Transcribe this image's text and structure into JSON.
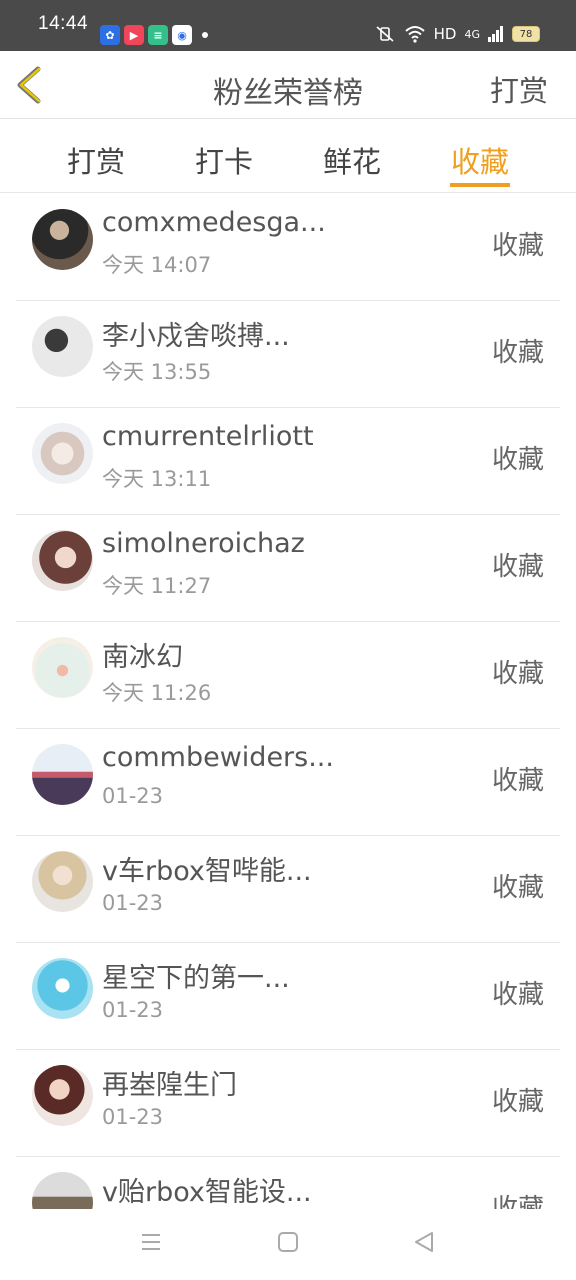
{
  "status_bar": {
    "time": "14:44",
    "network": "HD",
    "signal": "4G",
    "battery": "78"
  },
  "nav": {
    "title": "粉丝荣誉榜",
    "right_action": "打赏"
  },
  "tabs": [
    {
      "label": "打赏",
      "active": false
    },
    {
      "label": "打卡",
      "active": false
    },
    {
      "label": "鲜花",
      "active": false
    },
    {
      "label": "收藏",
      "active": true
    }
  ],
  "colors": {
    "accent": "#f0a020",
    "status_bar_bg": "#4a4a4a"
  },
  "fans": [
    {
      "name": "comxmedesga...",
      "time": "今天 14:07",
      "action": "收藏"
    },
    {
      "name": "李小戍舍啖搏...",
      "time": "今天 13:55",
      "action": "收藏"
    },
    {
      "name": "cmurrentelrliott",
      "time": "今天 13:11",
      "action": "收藏"
    },
    {
      "name": "simolneroichaz",
      "time": "今天 11:27",
      "action": "收藏"
    },
    {
      "name": "南冰幻",
      "time": "今天 11:26",
      "action": "收藏"
    },
    {
      "name": "commbewiders...",
      "time": "01-23",
      "action": "收藏"
    },
    {
      "name": "v车rbox智哔能...",
      "time": "01-23",
      "action": "收藏"
    },
    {
      "name": "星空下的第一...",
      "time": "01-23",
      "action": "收藏"
    },
    {
      "name": "再峚隍生门",
      "time": "01-23",
      "action": "收藏"
    },
    {
      "name": "v贻rbox智能设...",
      "time": "",
      "action": "收藏"
    }
  ]
}
